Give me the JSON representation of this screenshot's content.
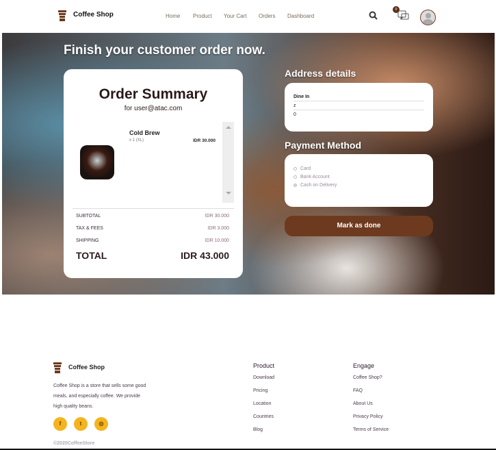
{
  "header": {
    "brand": "Coffee Shop",
    "nav": [
      "Home",
      "Product",
      "Your Cart",
      "Orders",
      "Dashboard"
    ],
    "notification_badge": "0",
    "icons": [
      "search-icon",
      "chat-icon",
      "avatar"
    ]
  },
  "hero": {
    "heading": "Finish your customer order now."
  },
  "order_summary": {
    "title": "Order Summary",
    "subtitle": "for user@atac.com",
    "items": [
      {
        "name": "Cold Brew",
        "qty": "x 1 (XL)",
        "price": "IDR 30.000"
      }
    ],
    "subtotal_label": "SUBTOTAL",
    "subtotal": "IDR 30.000",
    "tax_label": "TAX & FEES",
    "tax": "IDR 3.000",
    "shipping_label": "SHIPPING",
    "shipping": "IDR 10.000",
    "total_label": "TOTAL",
    "total": "IDR 43.000"
  },
  "address": {
    "title": "Address details",
    "lines": [
      "Dine In",
      "z",
      "0"
    ]
  },
  "payment": {
    "title": "Payment Method",
    "options": [
      "Card",
      "Bank Account",
      "Cash on Delivery"
    ],
    "selected": null
  },
  "mark_done_label": "Mark as done",
  "accent": "#6e3a1f",
  "footer": {
    "brand": "Coffee Shop",
    "description_lines": [
      "Coffee Shop is a store that sells some good",
      "meals, and especially coffee. We provide",
      "high quality beans."
    ],
    "social": [
      "facebook-icon",
      "twitter-icon",
      "instagram-icon"
    ],
    "product_title": "Product",
    "product_links": [
      "Download",
      "Pricing",
      "Location",
      "Countries",
      "Blog"
    ],
    "engage_title": "Engage",
    "engage_links": [
      "Coffee Shop?",
      "FAQ",
      "About Us",
      "Privacy Policy",
      "Terms of Service"
    ],
    "copyright": "©2020CoffeeStore"
  }
}
